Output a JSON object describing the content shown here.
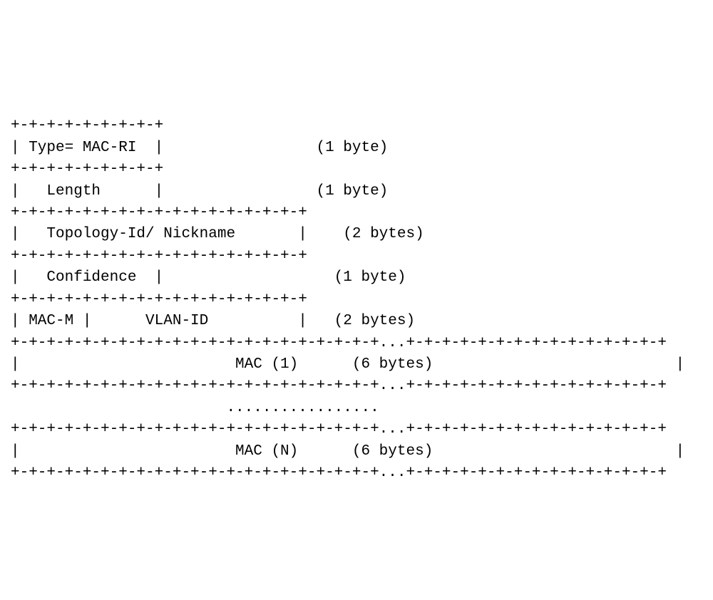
{
  "packet": {
    "border1": "+-+-+-+-+-+-+-+-+",
    "row1": "| Type= MAC-RI  |                 (1 byte)",
    "border2": "+-+-+-+-+-+-+-+-+",
    "row2": "|   Length      |                 (1 byte)",
    "border3": "+-+-+-+-+-+-+-+-+-+-+-+-+-+-+-+-+",
    "row3": "|   Topology-Id/ Nickname       |    (2 bytes)",
    "border4": "+-+-+-+-+-+-+-+-+-+-+-+-+-+-+-+-+",
    "row4": "|   Confidence  |                   (1 byte)",
    "border5": "+-+-+-+-+-+-+-+-+-+-+-+-+-+-+-+-+",
    "row5": "| MAC-M |      VLAN-ID          |   (2 bytes)",
    "border6": "+-+-+-+-+-+-+-+-+-+-+-+-+-+-+-+-+-+-+-+-+...+-+-+-+-+-+-+-+-+-+-+-+-+-+-+",
    "row6": "|                        MAC (1)      (6 bytes)                           |",
    "border7": "+-+-+-+-+-+-+-+-+-+-+-+-+-+-+-+-+-+-+-+-+...+-+-+-+-+-+-+-+-+-+-+-+-+-+-+",
    "row7": "                        .................",
    "border8": "+-+-+-+-+-+-+-+-+-+-+-+-+-+-+-+-+-+-+-+-+...+-+-+-+-+-+-+-+-+-+-+-+-+-+-+",
    "row8": "|                        MAC (N)      (6 bytes)                           |",
    "border9": "+-+-+-+-+-+-+-+-+-+-+-+-+-+-+-+-+-+-+-+-+...+-+-+-+-+-+-+-+-+-+-+-+-+-+-+"
  },
  "chart_data": {
    "type": "table",
    "title": "MAC-RI TLV Packet Format",
    "fields": [
      {
        "name": "Type",
        "value": "MAC-RI",
        "size_bytes": 1
      },
      {
        "name": "Length",
        "size_bytes": 1
      },
      {
        "name": "Topology-Id/ Nickname",
        "size_bytes": 2
      },
      {
        "name": "Confidence",
        "size_bytes": 1
      },
      {
        "name": "MAC-M / VLAN-ID",
        "size_bytes": 2,
        "subfields": [
          "MAC-M",
          "VLAN-ID"
        ]
      },
      {
        "name": "MAC (1)",
        "size_bytes": 6
      },
      {
        "name": "...",
        "repeat": true
      },
      {
        "name": "MAC (N)",
        "size_bytes": 6
      }
    ]
  }
}
